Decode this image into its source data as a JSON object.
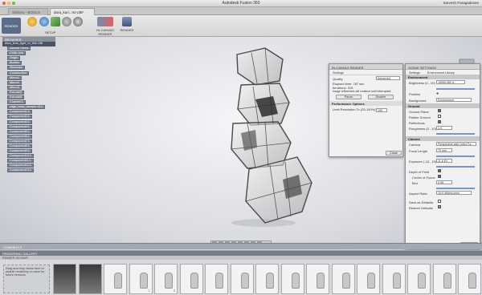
{
  "titlebar": {
    "title": "Autodesk Fusion 360",
    "user": "Sarvesh Paragadesee"
  },
  "tabs": [
    {
      "label": "Shiboru - BOOLS v2"
    },
    {
      "label": "dora_kuri...ist v36*"
    }
  ],
  "toolbar": {
    "render_label": "RENDER",
    "setup_label": "SETUP",
    "in_canvas_label": "IN-CANVAS RENDER",
    "render2_label": "RENDER"
  },
  "browser": {
    "header": "BROWSER",
    "root": "dora_kuro_type_m_thin v36",
    "items": [
      "Named Views",
      "Units: mm",
      "Origin",
      "Bodies",
      "Sketches",
      "Construction",
      "Mirror1",
      "Mirror2",
      "Mirror3",
      "Extrude5",
      "Extrude6",
      "Chamfer2",
      "cage_base_sample v3:1",
      "Component1:1",
      "Component2:1",
      "Component3:1",
      "Component4:1",
      "Component5:1",
      "Component6:1",
      "Component7:1",
      "Component8:1",
      "Component9:1",
      "Component10:1",
      "Component11:1",
      "Component12:1",
      "Component13:1"
    ]
  },
  "in_canvas": {
    "title": "IN-CANVAS RENDER",
    "settings_tab": "Settings",
    "quality_label": "Quality",
    "quality_value": "Advanced",
    "elapsed": "Elapsed time: 787 sec",
    "iterations": "Iterations: 315",
    "note": "Image refinement will continue until interrupted.",
    "pause": "Pause",
    "disable": "Disable",
    "perf_title": "Performance Options",
    "limit_label": "Limit Resolution To (25-100%)",
    "limit_value": "100",
    "close": "Close"
  },
  "scene": {
    "title": "SCENE SETTINGS",
    "settings_tab": "Settings",
    "env_tab": "Environment Library",
    "env_section": "Environment",
    "brightness_label": "Brightness (0...10)",
    "brightness_value": "15955.960 lx",
    "position_label": "Position",
    "background_label": "Background",
    "background_value": "Environment",
    "ground_section": "Ground",
    "ground_plane": "Ground Plane",
    "flatten_ground": "Flatten Ground",
    "reflections": "Reflections",
    "roughness_label": "Roughness (0...10)",
    "roughness_value": "1.5",
    "camera_section": "Camera",
    "camera_label": "Camera",
    "camera_value": "Perspective with Ortho Fa...",
    "focal_label": "Focal Length",
    "focal_value": "70 mm",
    "exposure_label": "Exposure (-15...15)",
    "exposure_value": "11.6 EV",
    "dof_label": "Depth of Field",
    "center_label": "Center of Focus",
    "blur_label": "Blur",
    "blur_value": "0.98",
    "aspect_label": "Aspect Ratio",
    "aspect_value": "16:9 Widescreen",
    "save_defaults": "Save as Defaults",
    "restore_defaults": "Restore Defaults",
    "close": "Close"
  },
  "comments_label": "COMMENTS",
  "gallery": {
    "header": "RENDERING GALLERY",
    "sub": "RENDER ON SAVE",
    "drag_hint": "Drag and drop views here to enable rendering on save for future versions",
    "thumbs": [
      "40",
      "40",
      "",
      "1",
      "5",
      "",
      "",
      "",
      "",
      "",
      "",
      "",
      "",
      "",
      "",
      "",
      ""
    ]
  }
}
